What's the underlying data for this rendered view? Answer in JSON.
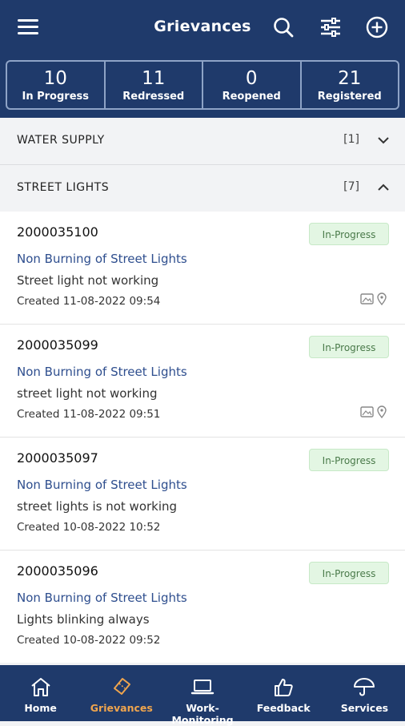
{
  "header": {
    "title": "Grievances",
    "menu_icon": "hamburger-menu-icon",
    "search_icon": "search-icon",
    "filter_icon": "sliders-filter-icon",
    "add_icon": "add-circle-icon"
  },
  "stats": [
    {
      "value": "10",
      "label": "In Progress",
      "active": true
    },
    {
      "value": "11",
      "label": "Redressed",
      "active": false
    },
    {
      "value": "0",
      "label": "Reopened",
      "active": false
    },
    {
      "value": "21",
      "label": "Registered",
      "active": false
    }
  ],
  "sections": [
    {
      "name": "WATER SUPPLY",
      "count": "[1]",
      "expanded": false
    },
    {
      "name": "STREET LIGHTS",
      "count": "[7]",
      "expanded": true
    }
  ],
  "grievances": [
    {
      "id": "2000035100",
      "status": "In-Progress",
      "category": "Non Burning of Street Lights",
      "description": "Street light not working",
      "created": "Created 11-08-2022 09:54",
      "has_attachments": true
    },
    {
      "id": "2000035099",
      "status": "In-Progress",
      "category": "Non Burning of Street Lights",
      "description": "street light not working",
      "created": "Created 11-08-2022 09:51",
      "has_attachments": true
    },
    {
      "id": "2000035097",
      "status": "In-Progress",
      "category": "Non Burning of Street Lights",
      "description": "street lights is not working",
      "created": "Created 10-08-2022 10:52",
      "has_attachments": false
    },
    {
      "id": "2000035096",
      "status": "In-Progress",
      "category": "Non Burning of Street Lights",
      "description": "Lights blinking always",
      "created": "Created 10-08-2022 09:52",
      "has_attachments": false
    }
  ],
  "bottom_nav": [
    {
      "label": "Home",
      "icon": "home-icon",
      "active": false
    },
    {
      "label": "Grievances",
      "icon": "ticket-icon",
      "active": true
    },
    {
      "label": "Work-Monitoring",
      "icon": "laptop-icon",
      "active": false
    },
    {
      "label": "Feedback",
      "icon": "thumbs-up-icon",
      "active": false
    },
    {
      "label": "Services",
      "icon": "umbrella-icon",
      "active": false
    }
  ],
  "colors": {
    "header_bg": "#1f3a6b",
    "active_accent": "#f0a54d",
    "status_badge_bg": "#e3f6e3",
    "category_link": "#2e4e8e"
  }
}
